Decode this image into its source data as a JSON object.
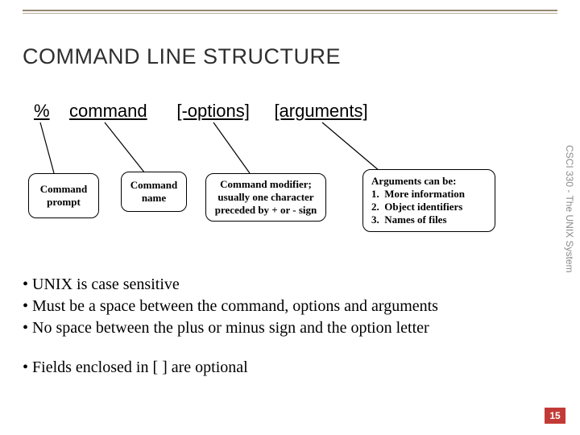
{
  "title": "COMMAND LINE STRUCTURE",
  "syntax": {
    "prompt": "%",
    "command": "command",
    "options": "[-options]",
    "arguments": "[arguments]"
  },
  "callouts": {
    "prompt": "Command prompt",
    "name": "Command name",
    "modifier": "Command modifier; usually one character preceded by + or - sign",
    "args_title": "Arguments can be:",
    "args_list": [
      "More information",
      "Object identifiers",
      "Names of files"
    ]
  },
  "bullets": [
    "UNIX is case sensitive",
    "Must be a space between the command, options and arguments",
    "No space between the plus or minus sign and the option letter"
  ],
  "bullets2": [
    "Fields enclosed in [ ] are optional"
  ],
  "sidetext": "CSCI 330 - The UNIX System",
  "page": "15"
}
